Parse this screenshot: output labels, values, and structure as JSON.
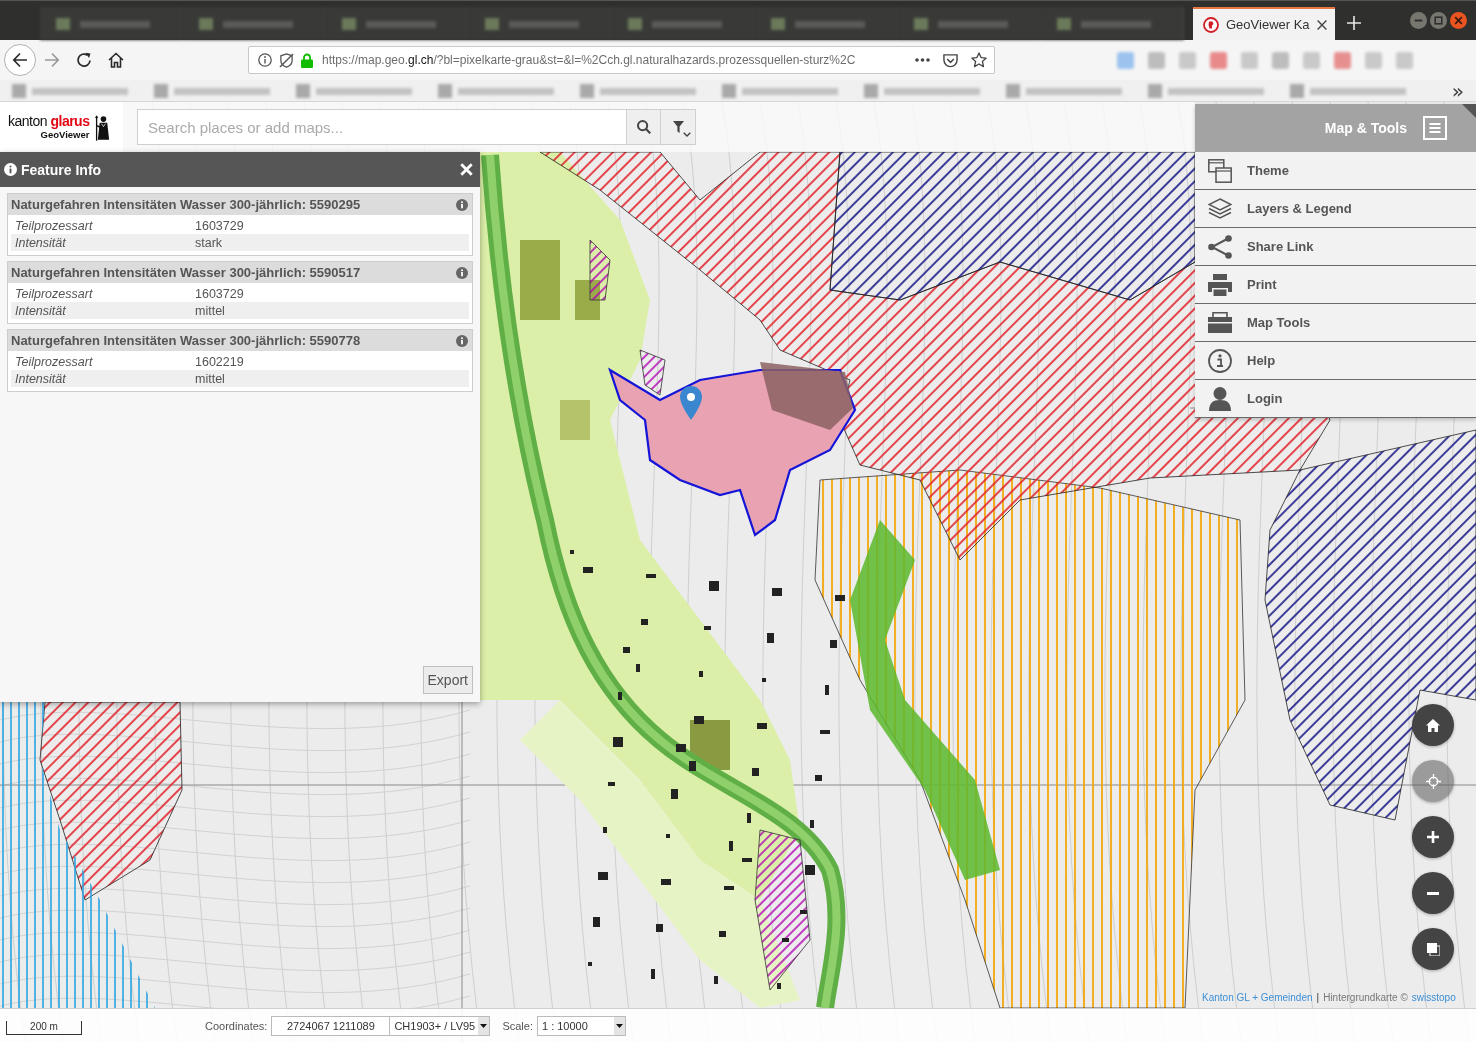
{
  "browser": {
    "tabs": [
      {
        "kind": "blurred",
        "selected": false
      },
      {
        "kind": "blurred",
        "selected": false
      },
      {
        "kind": "blurred",
        "selected": false
      },
      {
        "kind": "blurred",
        "selected": false
      },
      {
        "kind": "blurred",
        "selected": false
      },
      {
        "kind": "blurred",
        "selected": false
      },
      {
        "kind": "blurred",
        "selected": false
      },
      {
        "kind": "blurred",
        "selected": false
      },
      {
        "kind": "page",
        "label": "GeoViewer Ka",
        "selected": true
      }
    ],
    "url": "https://map.geo.**gl.ch**/?bl=pixelkarte-grau&st=&l=%2Cch.gl.naturalhazards.prozessquellen-sturz%2C",
    "bookmarks_overflow": "»"
  },
  "header": {
    "logo_title": "kanton **glarus**",
    "logo_subtitle": "GeoViewer",
    "search": {
      "placeholder": "Search places or add maps..."
    }
  },
  "feature_info": {
    "title": "Feature Info",
    "features": [
      {
        "title": "Naturgefahren Intensitäten Wasser 300-jährlich: 5590295",
        "rows": [
          {
            "label": "Teilprozessart",
            "value": "1603729"
          },
          {
            "label": "Intensität",
            "value": "stark"
          }
        ]
      },
      {
        "title": "Naturgefahren Intensitäten Wasser 300-jährlich: 5590517",
        "rows": [
          {
            "label": "Teilprozessart",
            "value": "1603729"
          },
          {
            "label": "Intensität",
            "value": "mittel"
          }
        ]
      },
      {
        "title": "Naturgefahren Intensitäten Wasser 300-jährlich: 5590778",
        "rows": [
          {
            "label": "Teilprozessart",
            "value": "1602219"
          },
          {
            "label": "Intensität",
            "value": "mittel"
          }
        ]
      }
    ],
    "export_button": "Export"
  },
  "tools_menu": {
    "title": "Map & Tools",
    "items": [
      {
        "label": "Theme"
      },
      {
        "label": "Layers & Legend"
      },
      {
        "label": "Share Link"
      },
      {
        "label": "Print"
      },
      {
        "label": "Map Tools"
      },
      {
        "label": "Help"
      },
      {
        "label": "Login"
      }
    ]
  },
  "map_controls": [
    {
      "disabled": false
    },
    {
      "disabled": true
    },
    {
      "disabled": false
    },
    {
      "disabled": false
    },
    {
      "disabled": false
    }
  ],
  "attribution": [
    {
      "kind": "link",
      "text": "Kanton GL + Gemeinden"
    },
    {
      "kind": "separator",
      "text": "|"
    },
    {
      "kind": "text",
      "text": "Hintergrundkarte ©"
    },
    {
      "kind": "link",
      "text": "swisstopo"
    }
  ],
  "status_bar": {
    "scale_bar": "200 m",
    "coordinates_label": "Coordinates:",
    "coordinates": "2724067 1211089",
    "projection": "CH1903+ / LV95",
    "scale_label": "Scale:",
    "scale": "1 : 10000"
  }
}
